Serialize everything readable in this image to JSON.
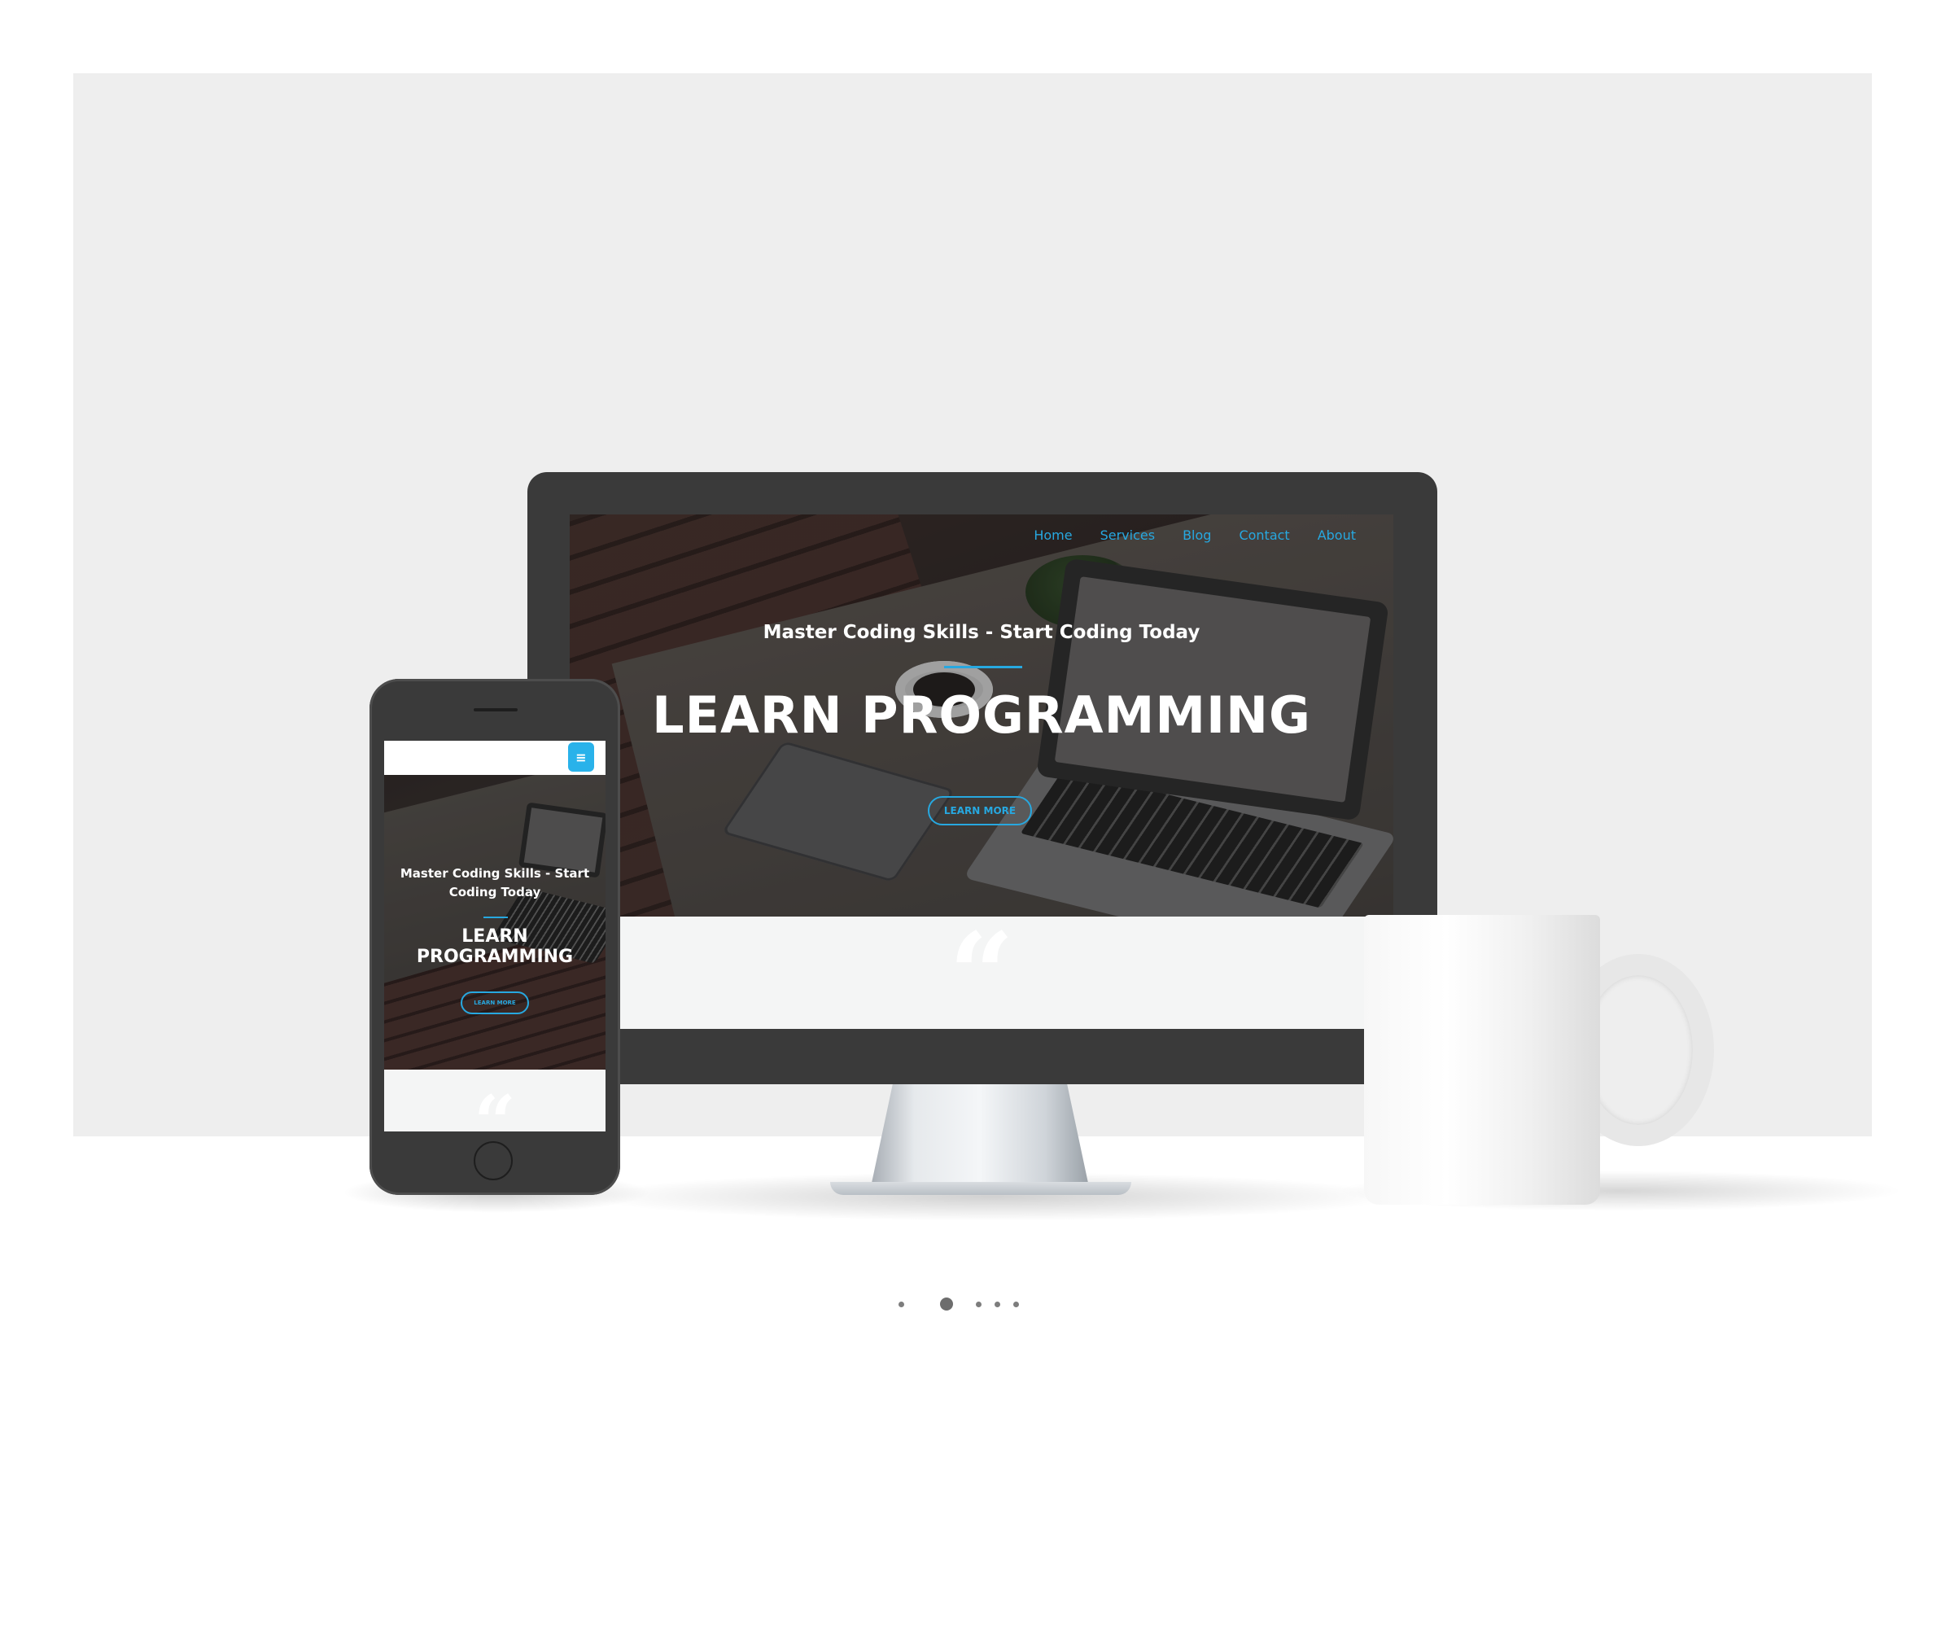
{
  "desktop": {
    "nav": [
      "Home",
      "Services",
      "Blog",
      "Contact",
      "About"
    ],
    "hero": {
      "subtitle": "Master Coding Skills - Start Coding Today",
      "title": "LEARN PROGRAMMING",
      "button_label": "LEARN MORE"
    },
    "quote_glyph": "“"
  },
  "mobile": {
    "menu_icon": "hamburger-menu-icon",
    "menu_glyph": "≡",
    "hero": {
      "subtitle": "Master Coding Skills - Start Coding Today",
      "title": "LEARN PROGRAMMING",
      "button_label": "LEARN MORE"
    },
    "quote_glyph": "“"
  },
  "carousel": {
    "slide_count": 5,
    "active_index": 1
  },
  "colors": {
    "accent": "#27a8e0",
    "menu_button": "#29b2ea",
    "backdrop": "#eeeeee",
    "device_body": "#3a3a3a"
  }
}
